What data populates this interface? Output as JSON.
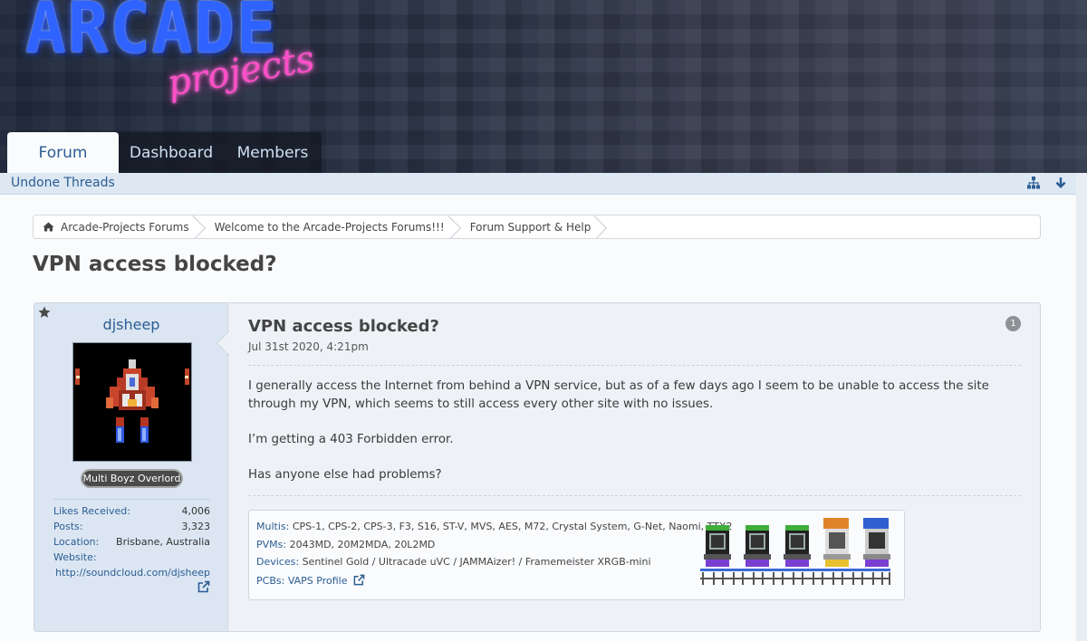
{
  "header": {
    "logo_main": "ARCADE",
    "logo_sub": "projects",
    "tabs": [
      {
        "label": "Forum"
      },
      {
        "label": "Dashboard"
      },
      {
        "label": "Members"
      }
    ],
    "subnav_link": "Undone Threads"
  },
  "breadcrumb": [
    {
      "label": "Arcade-Projects Forums"
    },
    {
      "label": "Welcome to the Arcade-Projects Forums!!!"
    },
    {
      "label": "Forum Support & Help"
    }
  ],
  "page_title": "VPN access blocked?",
  "post": {
    "username": "djsheep",
    "user_title": "Multi Boyz Overlord",
    "stats": {
      "likes_label": "Likes Received:",
      "likes_value": "4,006",
      "posts_label": "Posts:",
      "posts_value": "3,323",
      "location_label": "Location:",
      "location_value": "Brisbane, Australia",
      "website_label": "Website:",
      "website_value": "http://soundcloud.com/djsheep"
    },
    "title": "VPN access blocked?",
    "date": "Jul 31st 2020, 4:21pm",
    "number": "1",
    "body": [
      "I generally access the Internet from behind a VPN service, but as of a few days ago I seem to be unable to access the site through my VPN, which seems to still access every other site with no issues.",
      "I’m getting a 403 Forbidden error.",
      "Has anyone else had problems?"
    ],
    "signature": {
      "multis_label": "Multis:",
      "multis_value": "CPS-1, CPS-2, CPS-3, F3, S16, ST-V, MVS, AES, M72, Crystal System, G-Net, Naomi, TTX2",
      "pvms_label": "PVMs:",
      "pvms_value": "2043MD, 20M2MDA, 20L2MD",
      "devices_label": "Devices:",
      "devices_value": "Sentinel Gold / Ultracade uVC / JAMMAizer! / Framemeister XRGB-mini",
      "pcbs_label": "PCBs:",
      "pcbs_value": "VAPS Profile"
    }
  },
  "icons": {
    "home": "home-icon",
    "star": "star-icon",
    "sitemap": "sitemap-icon",
    "down_arrow": "arrow-down-icon",
    "external_link": "external-link-icon"
  },
  "colors": {
    "link": "#2b5d93",
    "header_bg": "#2d3648",
    "logo_blue": "#2f63ff",
    "logo_pink": "#ff4fc8",
    "user_cell_bg": "#dbe6f2",
    "post_bg": "#eef2f7"
  }
}
